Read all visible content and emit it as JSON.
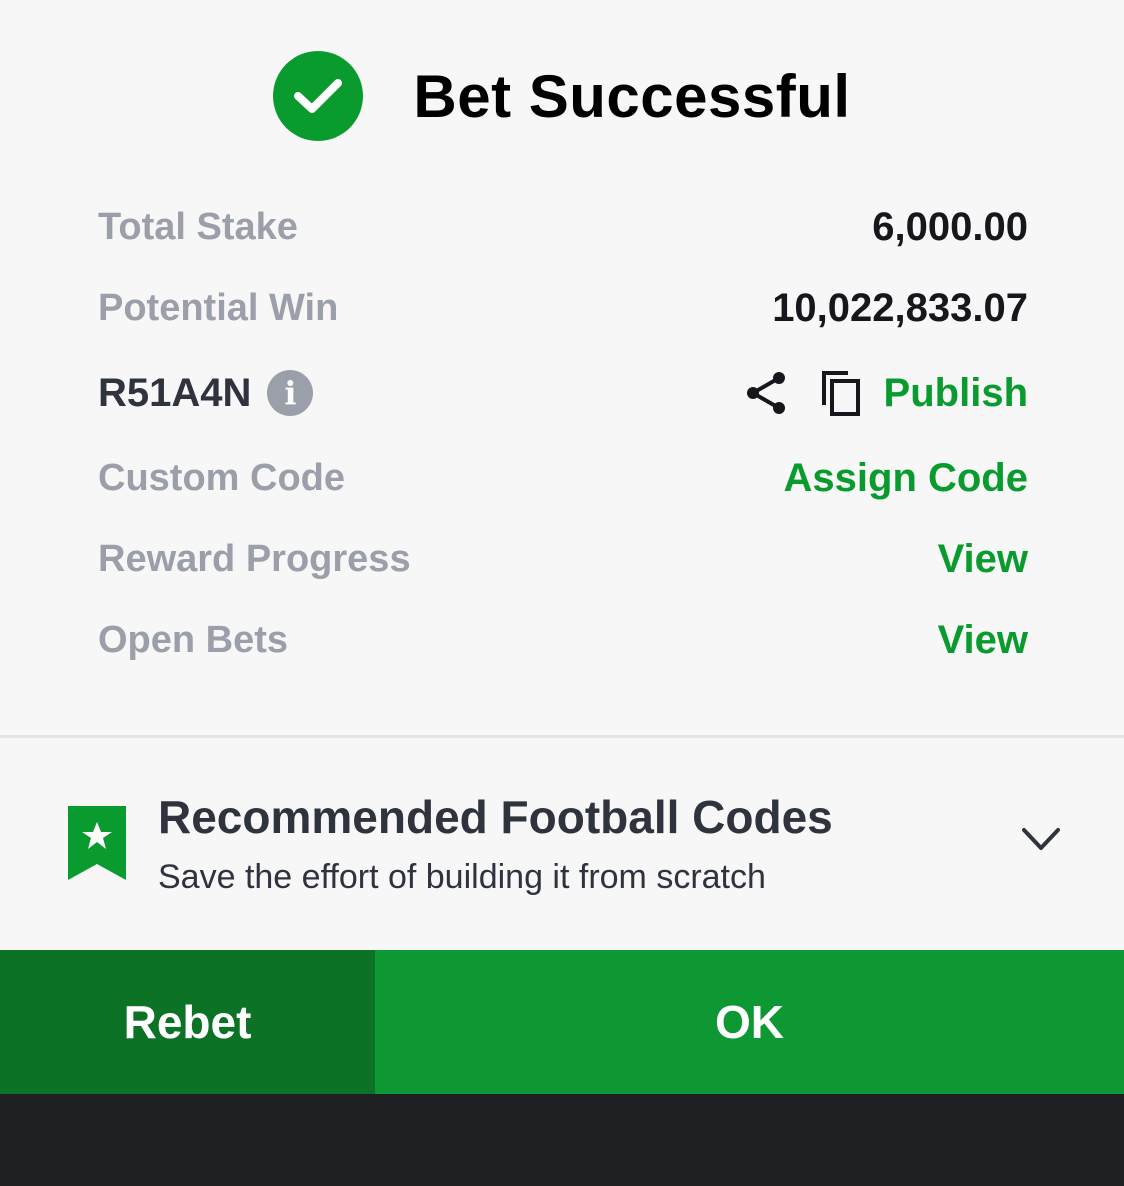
{
  "header": {
    "title": "Bet Successful",
    "icon": "check-circle-icon"
  },
  "summary": {
    "total_stake_label": "Total Stake",
    "total_stake_value": "6,000.00",
    "potential_win_label": "Potential Win",
    "potential_win_value": "10,022,833.07",
    "booking_code": "R51A4N",
    "info_glyph": "i",
    "publish_label": "Publish",
    "custom_code_label": "Custom Code",
    "assign_code_label": "Assign Code",
    "reward_progress_label": "Reward Progress",
    "reward_view_label": "View",
    "open_bets_label": "Open Bets",
    "open_bets_view_label": "View"
  },
  "recommended": {
    "title": "Recommended Football Codes",
    "subtitle": "Save the effort of building it from scratch"
  },
  "buttons": {
    "rebet": "Rebet",
    "ok": "OK"
  },
  "colors": {
    "accent_green": "#0a9b2e",
    "rebet_bg": "#0c7226",
    "ok_bg": "#0e9833",
    "label_gray": "#9b9fa9",
    "bottom_bar": "#1f2024"
  }
}
